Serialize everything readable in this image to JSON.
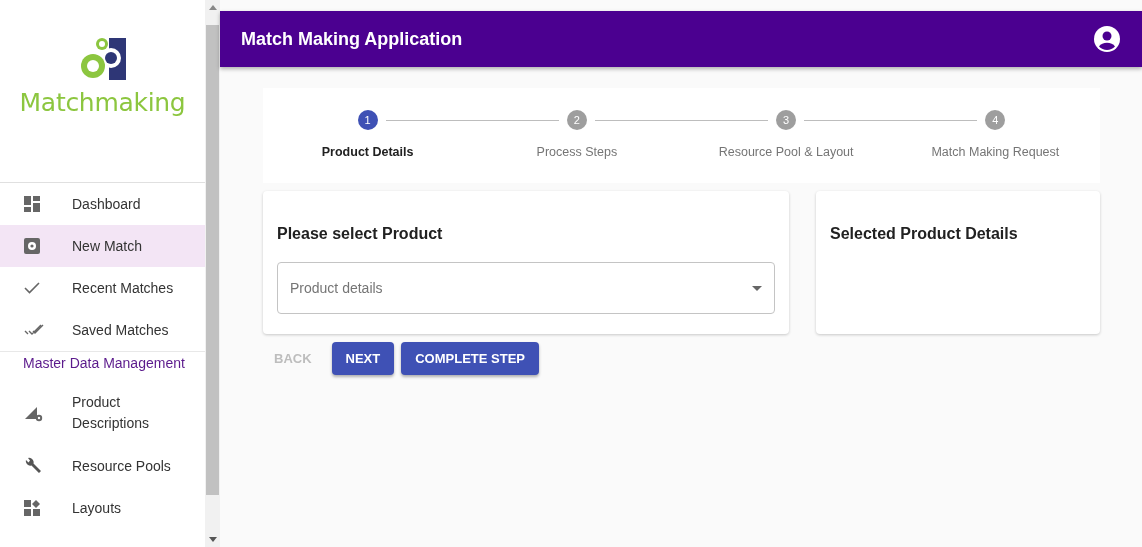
{
  "logo": {
    "text": "Matchmaking"
  },
  "sidebar": {
    "items": [
      {
        "kind": "item",
        "label": "Dashboard",
        "selected": false
      },
      {
        "kind": "item",
        "label": "New Match",
        "selected": true
      },
      {
        "kind": "item",
        "label": "Recent Matches",
        "selected": false
      },
      {
        "kind": "item",
        "label": "Saved Matches",
        "selected": false
      },
      {
        "kind": "section",
        "label": "Master Data Management"
      },
      {
        "kind": "item",
        "label": "Product Descriptions",
        "selected": false
      },
      {
        "kind": "item",
        "label": "Resource Pools",
        "selected": false
      },
      {
        "kind": "item",
        "label": "Layouts",
        "selected": false
      }
    ]
  },
  "app_bar": {
    "title": "Match Making Application"
  },
  "stepper": {
    "steps": [
      {
        "number": "1",
        "label": "Product Details",
        "selected": true
      },
      {
        "number": "2",
        "label": "Process Steps",
        "selected": false
      },
      {
        "number": "3",
        "label": "Resource Pool & Layout",
        "selected": false
      },
      {
        "number": "4",
        "label": "Match Making Request",
        "selected": false
      }
    ]
  },
  "product_card": {
    "title": "Please select Product",
    "select": {
      "placeholder": "Product details"
    }
  },
  "details_card": {
    "title": "Selected Product Details"
  },
  "buttons": [
    {
      "label": "BACK",
      "disabled": true
    },
    {
      "label": "NEXT",
      "disabled": false
    },
    {
      "label": "COMPLETE STEP",
      "disabled": false
    }
  ]
}
